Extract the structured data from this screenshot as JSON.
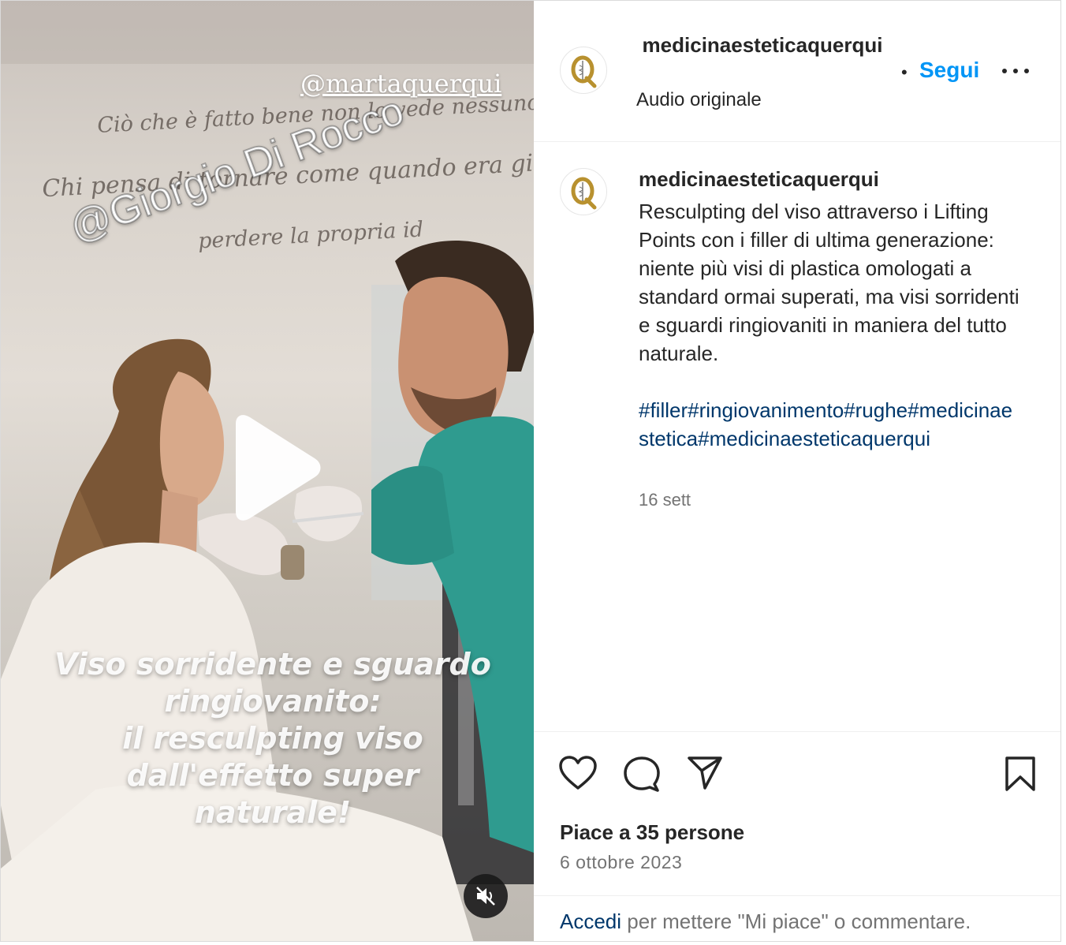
{
  "video": {
    "wall_text": [
      "Ciò che è fatto bene non lo vede nessuno.",
      "Chi pensa di tornare come quando era giovan",
      "perdere la propria id"
    ],
    "tag_top": "@martaquerqui",
    "tag_diagonal": "@Giorgio Di Rocco",
    "overlay_lines": [
      "Viso sorridente e sguardo",
      "ringiovanito:",
      "il resculpting viso",
      "dall'effetto super",
      "naturale!"
    ],
    "play_icon": "play-icon",
    "mute_icon": "speaker-muted-icon"
  },
  "header": {
    "username": "medicinaesteticaquerqui",
    "audio": "Audio originale",
    "separator": "•",
    "follow_label": "Segui",
    "more_icon": "more-horizontal-icon",
    "logo_letter": "Q"
  },
  "comment": {
    "username": "medicinaesteticaquerqui",
    "text": "Resculpting del viso attraverso i Lifting Points con i filler di ultima generazione: niente più visi di plastica omologati a standard ormai superati, ma visi sorridenti e sguardi ringiovaniti in maniera del tutto naturale.",
    "hashtags": [
      "#filler",
      "#ringiovanimento",
      "#rughe",
      "#medicinaestetica",
      "#medicinaesteticaquerqui"
    ],
    "date": "16 sett"
  },
  "actions": {
    "like_icon": "heart-icon",
    "comment_icon": "comment-icon",
    "share_icon": "send-icon",
    "save_icon": "bookmark-icon",
    "likes_text": "Piace a 35 persone",
    "post_date": "6 ottobre 2023"
  },
  "login": {
    "link_label": "Accedi",
    "rest_text": " per mettere \"Mi piace\" o commentare."
  },
  "colors": {
    "accent_blue": "#0095f6",
    "link_dark_blue": "#00376b",
    "secondary_text": "#737373",
    "logo_gold": "#b8912f"
  }
}
